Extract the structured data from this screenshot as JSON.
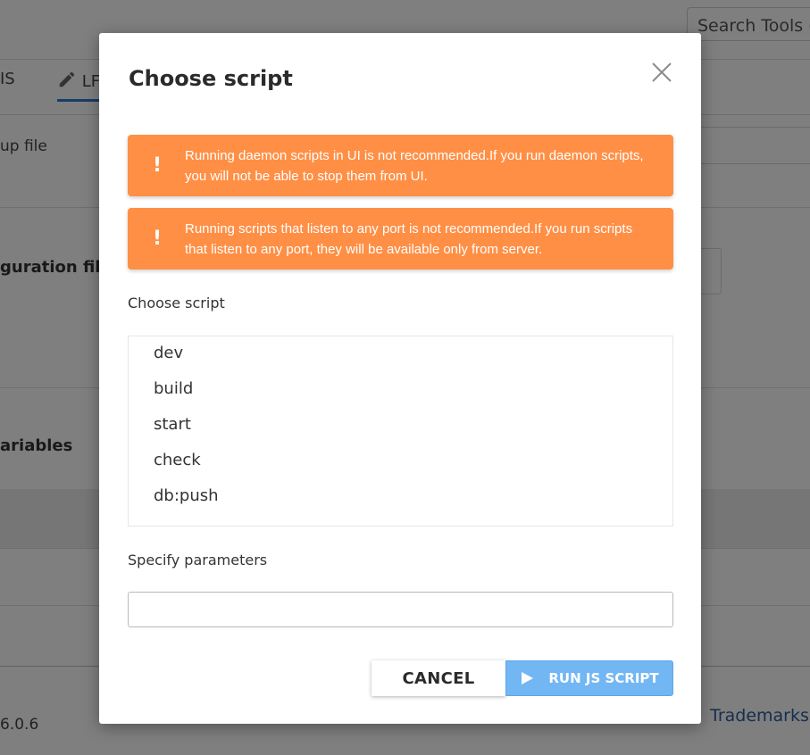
{
  "background": {
    "search_placeholder": "Search Tools (",
    "tab_previous": "IS",
    "tab_current": "LF",
    "setup_file_text": "up file",
    "config_files_heading": "guration files",
    "variables_heading": "ariables",
    "version": "6.0.6",
    "trademarks_link": "Trademarks"
  },
  "dialog": {
    "title": "Choose script",
    "alerts": [
      {
        "icon": "exclamation-icon",
        "bang": "!",
        "message": "Running daemon scripts in UI is not recommended.If you run daemon scripts, you will not be able to stop them from UI."
      },
      {
        "icon": "exclamation-icon",
        "bang": "!",
        "message": "Running scripts that listen to any port is not recommended.If you run scripts that listen to any port, they will be available only from server."
      }
    ],
    "choose_label": "Choose script",
    "scripts": [
      "dev",
      "build",
      "start",
      "check",
      "db:push"
    ],
    "params_label": "Specify parameters",
    "params_value": "",
    "cancel_label": "CANCEL",
    "run_label": "RUN JS SCRIPT"
  },
  "colors": {
    "alert_bg": "#ff8f45",
    "run_button_bg": "#72b6f4",
    "link": "#2c5d9e",
    "tab_underline": "#2f7bd0"
  }
}
